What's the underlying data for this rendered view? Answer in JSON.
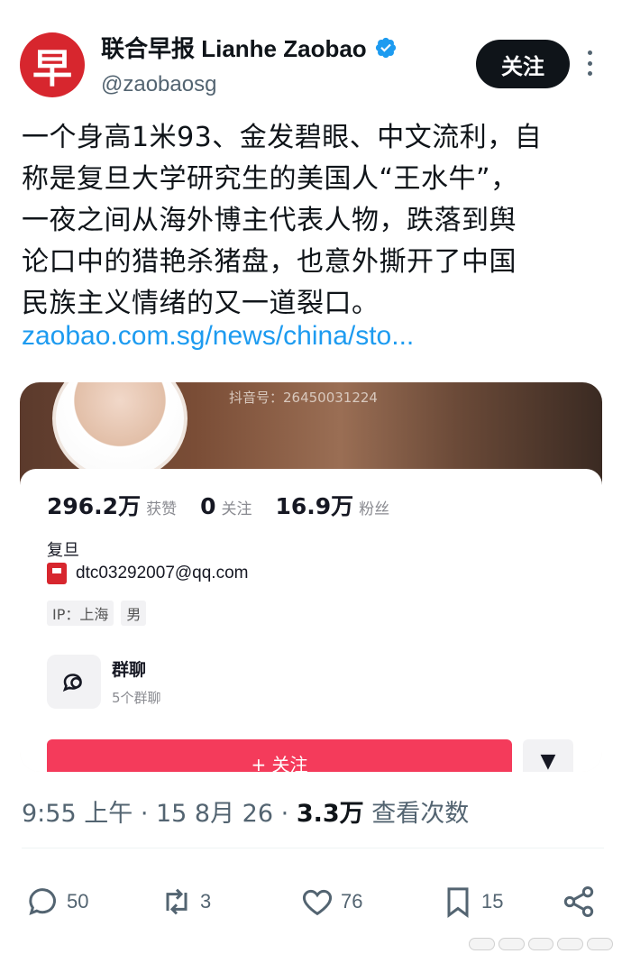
{
  "header": {
    "avatar_glyph": "早",
    "display_name": "联合早报 Lianhe Zaobao",
    "handle": "@zaobaosg",
    "follow_label": "关注",
    "verified_icon": "verified-badge-icon",
    "more_icon": "more-vertical-icon"
  },
  "tweet": {
    "text_lines": [
      "一个身高1米93、金发碧眼、中文流利，自",
      "称是复旦大学研究生的美国人“王水牛”，",
      "一夜之间从海外博主代表人物，跌落到舆",
      "论口中的猎艳杀猪盘，也意外撕开了中国",
      "民族主义情绪的又一道裂口。"
    ],
    "link": "zaobao.com.sg/news/china/sto..."
  },
  "media": {
    "douyin_id": "抖音号：26450031224",
    "stats": [
      {
        "value": "296.2万",
        "label": "获赞"
      },
      {
        "value": "0",
        "label": "关注"
      },
      {
        "value": "16.9万",
        "label": "粉丝"
      }
    ],
    "school": "复旦",
    "email": "dtc03292007@qq.com",
    "tags": [
      "IP：上海",
      "男"
    ],
    "group_title": "群聊",
    "group_sub": "5个群聊",
    "follow_label": "+ 关注",
    "more_label": "▼"
  },
  "meta": {
    "time": "9:55 上午",
    "date": "15 8月 26",
    "views": "3.3万",
    "views_label": "查看次数"
  },
  "actions": {
    "reply_count": "50",
    "retweet_count": "3",
    "like_count": "76",
    "bookmark_count": "15"
  },
  "colors": {
    "brand": "#d7262e",
    "link": "#1d9bf0",
    "button_dark": "#0f1419",
    "muted": "#536471",
    "douyin_red": "#f43b5b"
  }
}
